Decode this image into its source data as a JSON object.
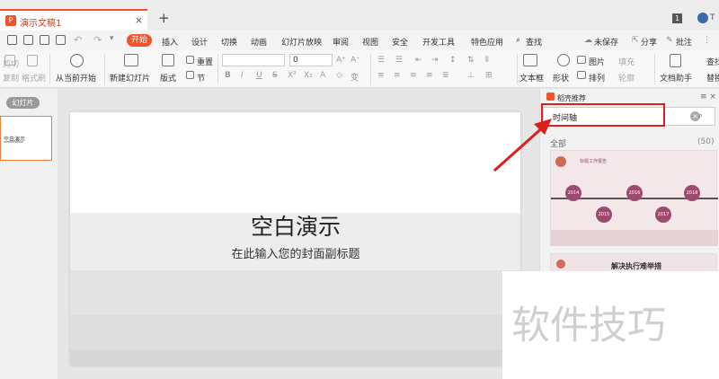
{
  "titlebar": {
    "doc_name": "演示文稿1",
    "close_glyph": "×",
    "new_tab_glyph": "+",
    "window_count": "1",
    "user_initial": "T"
  },
  "menubar": {
    "start": "开始",
    "items": [
      "插入",
      "设计",
      "切换",
      "动画",
      "幻灯片放映",
      "审阅",
      "视图",
      "安全",
      "开发工具",
      "特色应用",
      "查找"
    ],
    "unsaved": "未保存",
    "share": "分享",
    "comment": "批注"
  },
  "ribbon": {
    "cut": "剪切",
    "copy": "复制",
    "format_painter": "格式刷",
    "play_from_current": "从当前开始",
    "new_slide": "新建幻灯片",
    "layout": "版式",
    "reset": "重置",
    "section": "节",
    "font_size": "0",
    "bold": "B",
    "italic": "I",
    "underline": "U",
    "strike": "S",
    "textbox": "文本框",
    "shape": "形状",
    "picture": "图片",
    "fill": "填充",
    "arrange": "排列",
    "outline": "轮廓",
    "doc_assistant": "文档助手",
    "find": "查找",
    "replace": "替换"
  },
  "left_panel": {
    "tab": "幻灯片",
    "thumb_title": "空白演示"
  },
  "slide": {
    "title": "空白演示",
    "subtitle": "在此输入您的封面副标题"
  },
  "right_panel": {
    "title": "稻壳推荐",
    "search_value": "时间轴",
    "result_label": "全部",
    "result_count": "(50)",
    "card1_title": "标题工作报告",
    "card1_years": [
      "2014",
      "2016",
      "2018",
      "2015",
      "2017"
    ],
    "card2_title": "解决执行难举措"
  },
  "watermark": "软件技巧",
  "colors": {
    "accent": "#f0542d",
    "highlight": "#d9201c",
    "timeline_dot": "#9c4a6e"
  }
}
